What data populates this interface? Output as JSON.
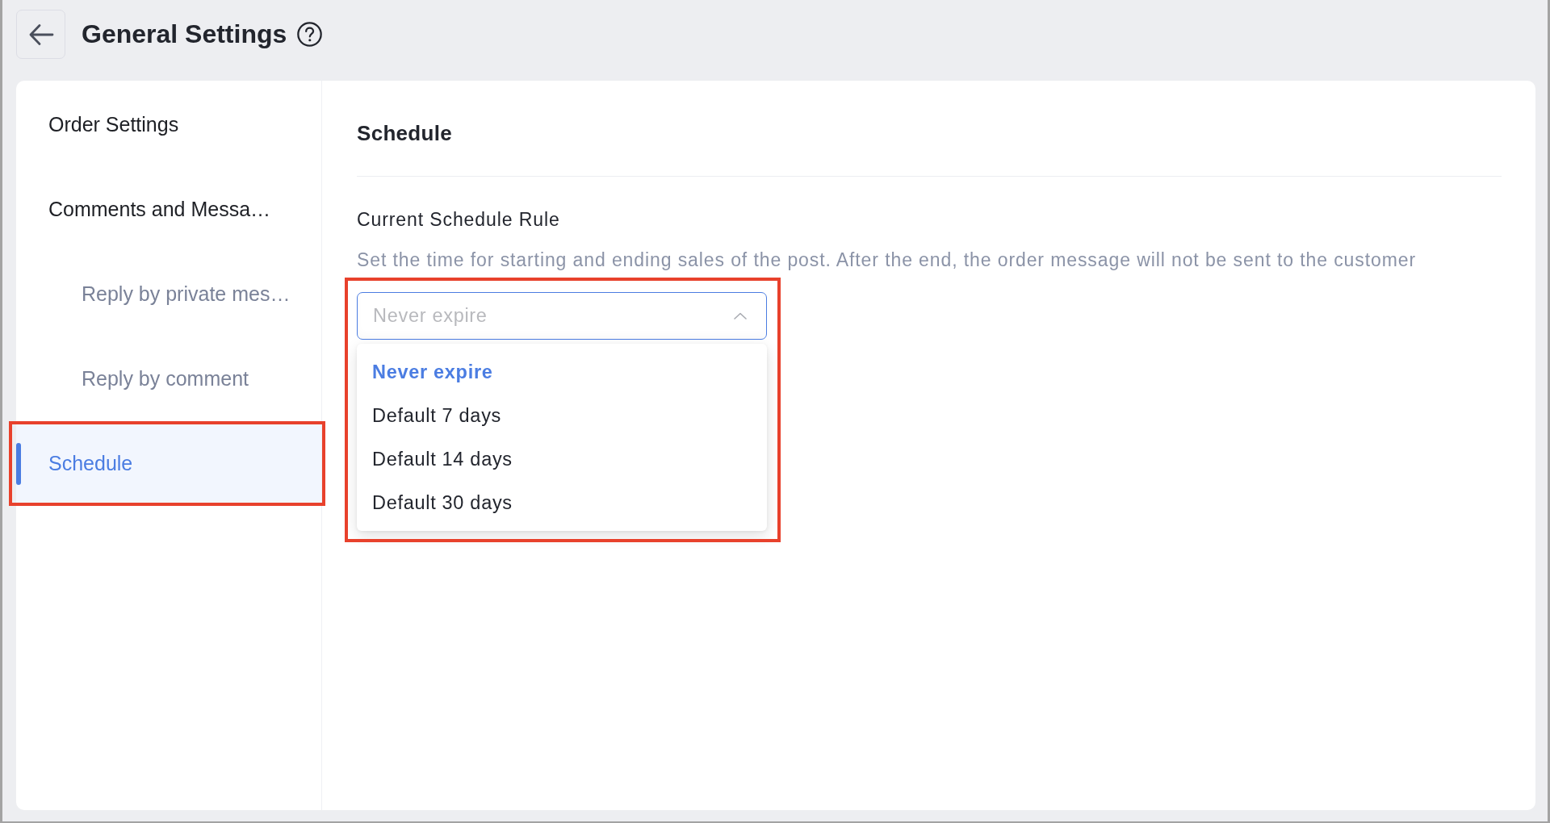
{
  "header": {
    "title": "General Settings"
  },
  "sidebar": {
    "items": [
      {
        "label": "Order Settings",
        "selected": false,
        "highlighted": false
      },
      {
        "label": "Comments and Messa…",
        "selected": false,
        "highlighted": false,
        "children": [
          {
            "label": "Reply by private mes…",
            "selected": false,
            "highlighted": false
          },
          {
            "label": "Reply by comment",
            "selected": false,
            "highlighted": false
          }
        ]
      },
      {
        "label": "Schedule",
        "selected": true,
        "highlighted": true
      }
    ]
  },
  "content": {
    "title": "Schedule",
    "section": {
      "label": "Current Schedule Rule",
      "description": "Set the time for starting and ending sales of the post. After the end, the order message will not be sent to the customer",
      "select": {
        "value": "Never expire",
        "expanded": true,
        "highlighted": true,
        "options": [
          {
            "label": "Never expire",
            "selected": true
          },
          {
            "label": "Default 7 days",
            "selected": false
          },
          {
            "label": "Default 14 days",
            "selected": false
          },
          {
            "label": "Default 30 days",
            "selected": false
          }
        ]
      }
    }
  }
}
